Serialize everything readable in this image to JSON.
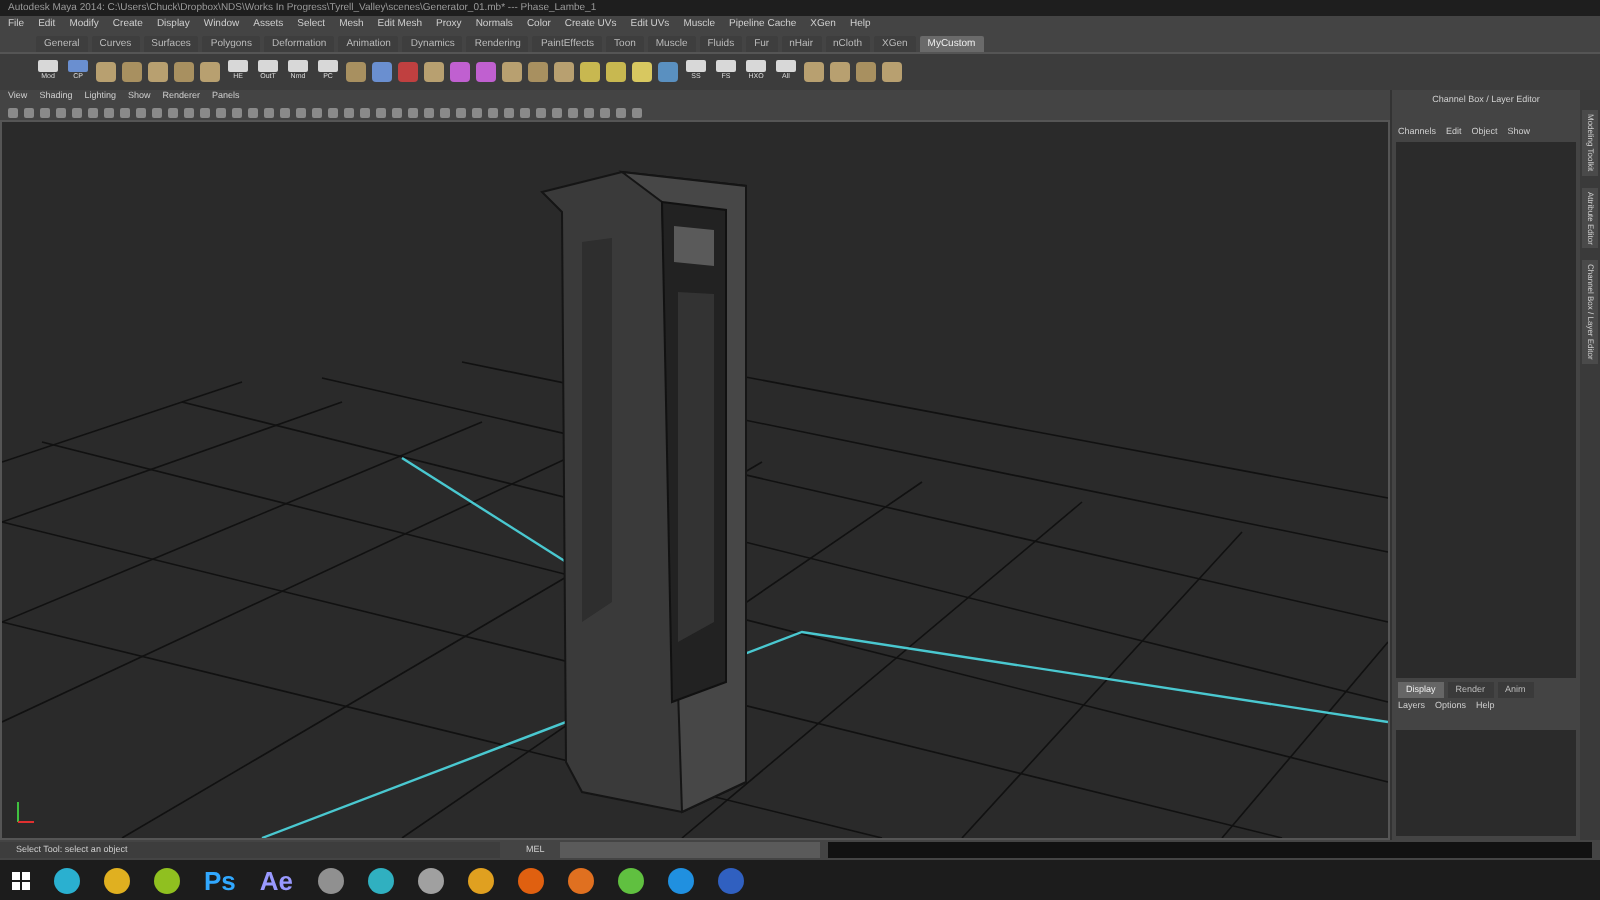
{
  "window": {
    "title": "Autodesk Maya 2014: C:\\Users\\Chuck\\Dropbox\\NDS\\Works In Progress\\Tyrell_Valley\\scenes\\Generator_01.mb*  ---  Phase_Lambe_1"
  },
  "menu": [
    "File",
    "Edit",
    "Modify",
    "Create",
    "Display",
    "Window",
    "Assets",
    "Select",
    "Mesh",
    "Edit Mesh",
    "Proxy",
    "Normals",
    "Color",
    "Create UVs",
    "Edit UVs",
    "Muscle",
    "Pipeline Cache",
    "XGen",
    "Help"
  ],
  "shelf_tabs": [
    {
      "label": "General",
      "selected": false
    },
    {
      "label": "Curves",
      "selected": false
    },
    {
      "label": "Surfaces",
      "selected": false
    },
    {
      "label": "Polygons",
      "selected": false
    },
    {
      "label": "Deformation",
      "selected": false
    },
    {
      "label": "Animation",
      "selected": false
    },
    {
      "label": "Dynamics",
      "selected": false
    },
    {
      "label": "Rendering",
      "selected": false
    },
    {
      "label": "PaintEffects",
      "selected": false
    },
    {
      "label": "Toon",
      "selected": false
    },
    {
      "label": "Muscle",
      "selected": false
    },
    {
      "label": "Fluids",
      "selected": false
    },
    {
      "label": "Fur",
      "selected": false
    },
    {
      "label": "nHair",
      "selected": false
    },
    {
      "label": "nCloth",
      "selected": false
    },
    {
      "label": "XGen",
      "selected": false
    },
    {
      "label": "MyCustom",
      "selected": true
    }
  ],
  "shelf_buttons": [
    {
      "kind": "labeled",
      "label": "Mod",
      "color": "#d8d8d8"
    },
    {
      "kind": "labeled",
      "label": "CP",
      "color": "#6a8fd0"
    },
    {
      "kind": "icon",
      "color": "#b8a070"
    },
    {
      "kind": "icon",
      "color": "#a89060"
    },
    {
      "kind": "icon",
      "color": "#b8a070"
    },
    {
      "kind": "icon",
      "color": "#a89060"
    },
    {
      "kind": "icon",
      "color": "#b8a070"
    },
    {
      "kind": "labeled",
      "label": "HE",
      "color": "#d8d8d8"
    },
    {
      "kind": "labeled",
      "label": "OutT",
      "color": "#d8d8d8"
    },
    {
      "kind": "labeled",
      "label": "Nmd",
      "color": "#d8d8d8"
    },
    {
      "kind": "labeled",
      "label": "PC",
      "color": "#d8d8d8"
    },
    {
      "kind": "icon",
      "color": "#a89060"
    },
    {
      "kind": "icon",
      "color": "#6a8fd0"
    },
    {
      "kind": "icon",
      "color": "#c04040"
    },
    {
      "kind": "icon",
      "color": "#b8a070"
    },
    {
      "kind": "icon",
      "color": "#c060d0"
    },
    {
      "kind": "icon",
      "color": "#c060d0"
    },
    {
      "kind": "icon",
      "color": "#b8a070"
    },
    {
      "kind": "icon",
      "color": "#a89060"
    },
    {
      "kind": "icon",
      "color": "#b8a070"
    },
    {
      "kind": "icon",
      "color": "#c8b850"
    },
    {
      "kind": "icon",
      "color": "#c8b850"
    },
    {
      "kind": "icon",
      "color": "#d8c860"
    },
    {
      "kind": "icon",
      "color": "#5a90c0"
    },
    {
      "kind": "labeled",
      "label": "SS",
      "color": "#d8d8d8"
    },
    {
      "kind": "labeled",
      "label": "FS",
      "color": "#d8d8d8"
    },
    {
      "kind": "labeled",
      "label": "HXO",
      "color": "#d8d8d8"
    },
    {
      "kind": "labeled",
      "label": "All",
      "color": "#d8d8d8"
    },
    {
      "kind": "icon",
      "color": "#b8a070"
    },
    {
      "kind": "icon",
      "color": "#b8a070"
    },
    {
      "kind": "icon",
      "color": "#a89060"
    },
    {
      "kind": "icon",
      "color": "#b8a070"
    }
  ],
  "panel_menu": [
    "View",
    "Shading",
    "Lighting",
    "Show",
    "Renderer",
    "Panels"
  ],
  "channel_box": {
    "title": "Channel Box / Layer Editor",
    "menu": [
      "Channels",
      "Edit",
      "Object",
      "Show"
    ]
  },
  "side_tabs": [
    "Modeling Toolkit",
    "Attribute Editor",
    "Channel Box / Layer Editor"
  ],
  "layer_editor": {
    "tabs": [
      {
        "label": "Display",
        "selected": true
      },
      {
        "label": "Render",
        "selected": false
      },
      {
        "label": "Anim",
        "selected": false
      }
    ],
    "menu": [
      "Layers",
      "Options",
      "Help"
    ]
  },
  "status_bar": {
    "help_line": "Select Tool: select an object",
    "command_label": "MEL"
  },
  "taskbar": [
    {
      "kind": "icon",
      "color": "#2ab0d0"
    },
    {
      "kind": "icon",
      "color": "#e0b020"
    },
    {
      "kind": "icon",
      "color": "#90c020"
    },
    {
      "kind": "text",
      "label": "Ps",
      "color": "#31a8ff"
    },
    {
      "kind": "text",
      "label": "Ae",
      "color": "#9999ff"
    },
    {
      "kind": "icon",
      "color": "#909090"
    },
    {
      "kind": "icon",
      "color": "#30b0c0"
    },
    {
      "kind": "icon",
      "color": "#a0a0a0"
    },
    {
      "kind": "icon",
      "color": "#e0a020"
    },
    {
      "kind": "icon",
      "color": "#e06010"
    },
    {
      "kind": "icon",
      "color": "#e07020"
    },
    {
      "kind": "icon",
      "color": "#60c040"
    },
    {
      "kind": "icon",
      "color": "#2090e0"
    },
    {
      "kind": "icon",
      "color": "#3060c0"
    }
  ]
}
